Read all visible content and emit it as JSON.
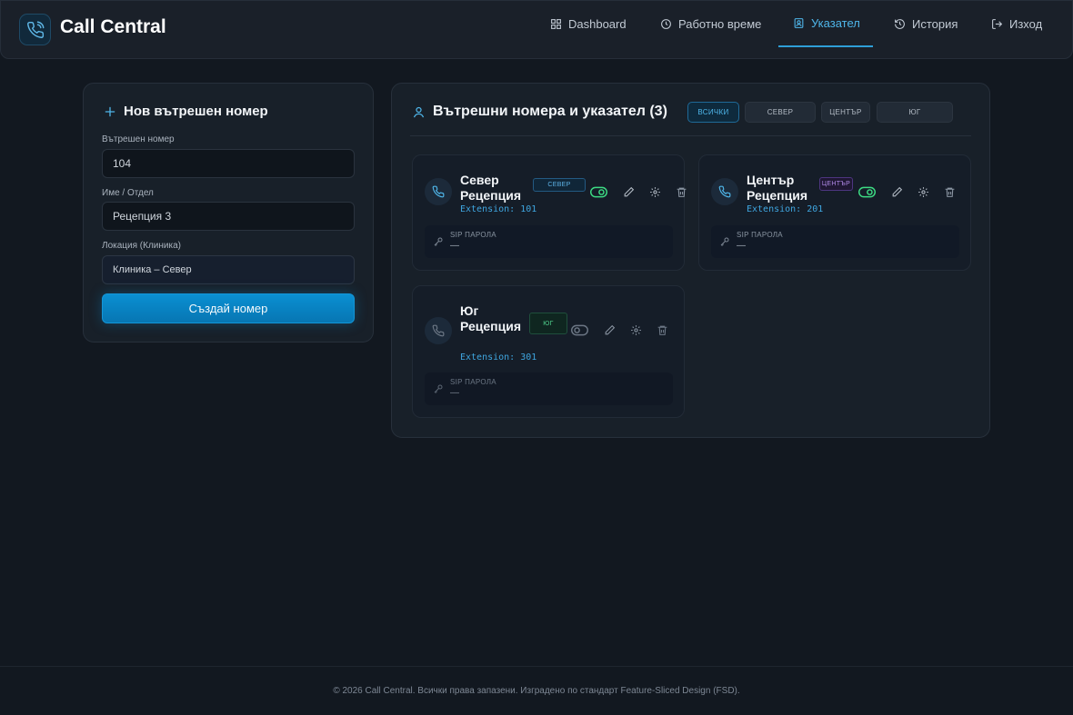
{
  "app": {
    "title": "Call Central"
  },
  "nav": {
    "items": [
      {
        "label": "Dashboard",
        "icon": "grid-icon"
      },
      {
        "label": "Работно време",
        "icon": "clock-icon"
      },
      {
        "label": "Указател",
        "icon": "contact-card-icon",
        "active": true
      },
      {
        "label": "История",
        "icon": "history-icon"
      },
      {
        "label": "Изход",
        "icon": "logout-icon"
      }
    ]
  },
  "form": {
    "title": "Нов вътрешен номер",
    "extension_label": "Вътрешен номер",
    "extension_value": "104",
    "name_label": "Име / Отдел",
    "name_value": "Рецепция 3",
    "location_label": "Локация (Клиника)",
    "location_value": "Клиника – Север",
    "submit_label": "Създай номер"
  },
  "directory": {
    "title": "Вътрешни номера и указател (3)",
    "filters": [
      "ВСИЧКИ",
      "СЕВЕР",
      "ЦЕНТЪР",
      "ЮГ"
    ],
    "active_filter": "ВСИЧКИ",
    "entries": [
      {
        "name": "Север Рецепция",
        "badge": "СЕВЕР",
        "badge_color": "#3a8fd0",
        "extension": "Extension: 101",
        "enabled": true,
        "sip_label": "SIP ПАРОЛА",
        "sip_value": "—"
      },
      {
        "name": "Център Рецепция",
        "badge": "ЦЕНТЪР",
        "badge_color": "#9b6ad8",
        "extension": "Extension: 201",
        "enabled": true,
        "sip_label": "SIP ПАРОЛА",
        "sip_value": "—"
      },
      {
        "name": "Юг Рецепция",
        "badge": "ЮГ",
        "badge_color": "#3dbb7a",
        "extension": "Extension: 301",
        "enabled": false,
        "sip_label": "SIP ПАРОЛА",
        "sip_value": "—"
      }
    ]
  },
  "footer": {
    "text": "© 2026 Call Central. Всички права запазени. Изградено по стандарт Feature-Sliced Design (FSD)."
  },
  "colors": {
    "accent": "#2f9fd8",
    "toggle_on": "#3ddc84",
    "background": "#121820"
  }
}
